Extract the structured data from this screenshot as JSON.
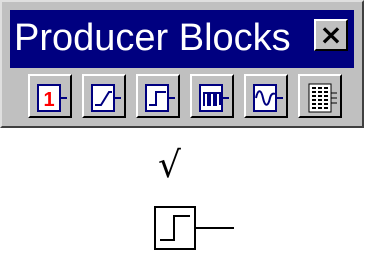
{
  "palette": {
    "title": "Producer Blocks",
    "close_label": "×",
    "buttons": [
      {
        "icon": "constant-icon",
        "label": "1"
      },
      {
        "icon": "ramp-icon"
      },
      {
        "icon": "step-icon"
      },
      {
        "icon": "pulse-train-icon"
      },
      {
        "icon": "sine-wave-icon"
      },
      {
        "icon": "data-table-icon"
      }
    ]
  },
  "annotation": {
    "checkmark": "√"
  },
  "colors": {
    "titlebar_bg": "#000080",
    "title_text": "#ffffff",
    "panel": "#c0c0c0",
    "constant_value": "#ff0000",
    "icon_blue": "#000080"
  }
}
